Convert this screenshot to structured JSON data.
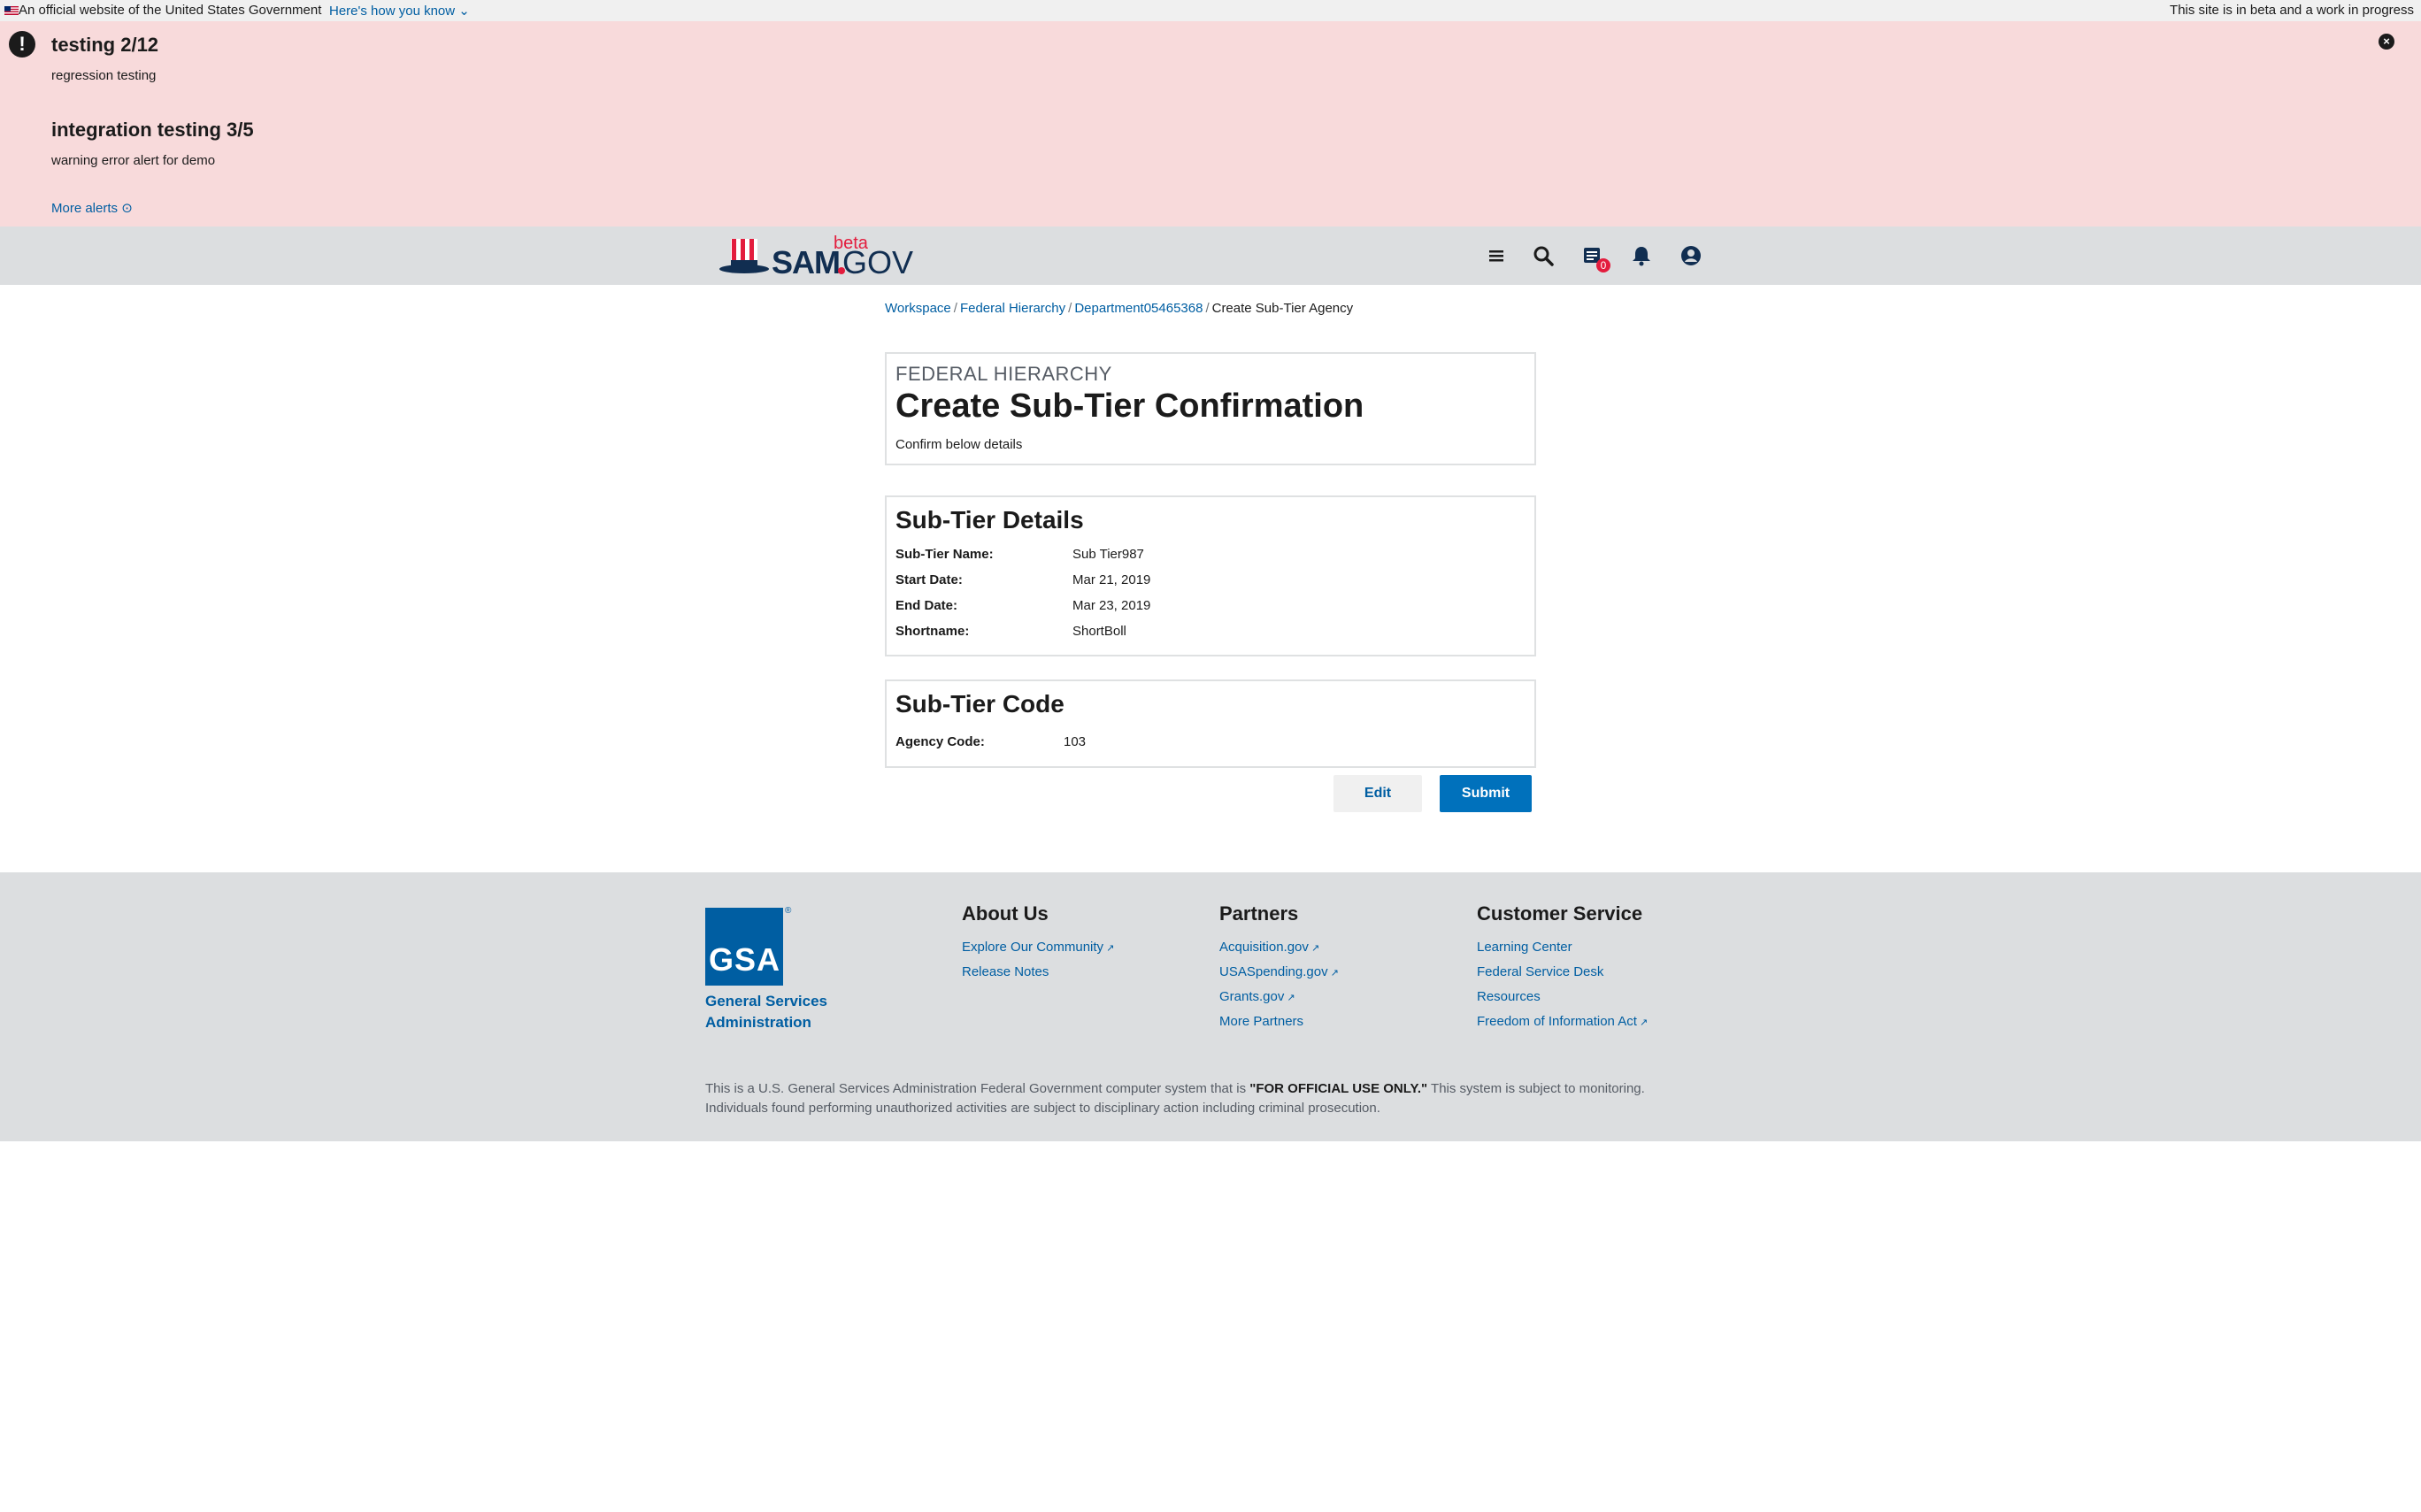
{
  "gov_banner": {
    "official": "An official website of the United States Government",
    "how_you_know": "Here's how you know",
    "beta_notice": "This site is in beta and a work in progress"
  },
  "alerts": {
    "items": [
      {
        "title": "testing 2/12",
        "body": "regression testing"
      },
      {
        "title": "integration testing 3/5",
        "body": "warning error alert for demo"
      }
    ],
    "more": "More alerts"
  },
  "header": {
    "logo_sam": "SAM",
    "logo_gov": "GOV",
    "logo_beta": "beta",
    "messages_count": "0",
    "icons": [
      "menu-icon",
      "search-icon",
      "messages-icon",
      "bell-icon",
      "user-icon"
    ]
  },
  "breadcrumb": {
    "items": [
      "Workspace",
      "Federal Hierarchy",
      "Department05465368"
    ],
    "current": "Create Sub-Tier Agency"
  },
  "confirmation": {
    "eyebrow": "FEDERAL HIERARCHY",
    "title": "Create Sub-Tier Confirmation",
    "subtitle": "Confirm below details"
  },
  "details": {
    "title": "Sub-Tier Details",
    "rows": [
      {
        "label": "Sub-Tier Name:",
        "value": "Sub Tier987"
      },
      {
        "label": "Start Date:",
        "value": "Mar 21, 2019"
      },
      {
        "label": "End Date:",
        "value": "Mar 23, 2019"
      },
      {
        "label": "Shortname:",
        "value": "ShortBoll"
      }
    ]
  },
  "code": {
    "title": "Sub-Tier Code",
    "label": "Agency Code:",
    "value": "103"
  },
  "actions": {
    "edit": "Edit",
    "submit": "Submit"
  },
  "footer": {
    "gsa_logo": "GSA",
    "gsa_name": "General Services Administration",
    "columns": [
      {
        "heading": "About Us",
        "links": [
          "Explore Our Community",
          "Release Notes"
        ]
      },
      {
        "heading": "Partners",
        "links": [
          "Acquisition.gov",
          "USASpending.gov",
          "Grants.gov",
          "More Partners"
        ]
      },
      {
        "heading": "Customer Service",
        "links": [
          "Learning Center",
          "Federal Service Desk",
          "Resources",
          "Freedom of Information Act"
        ]
      }
    ],
    "disclaimer_pre": "This is a U.S. General Services Administration Federal Government computer system that is ",
    "disclaimer_bold": "\"FOR OFFICIAL USE ONLY.\"",
    "disclaimer_post": " This system is subject to monitoring. Individuals found performing unauthorized activities are subject to disciplinary action including criminal prosecution."
  },
  "colors": {
    "alert_bg": "#f8dadb",
    "header_bg": "#dcdee0",
    "link": "#005ea2",
    "primary_button": "#0071bc",
    "badge": "#e31c3d"
  }
}
